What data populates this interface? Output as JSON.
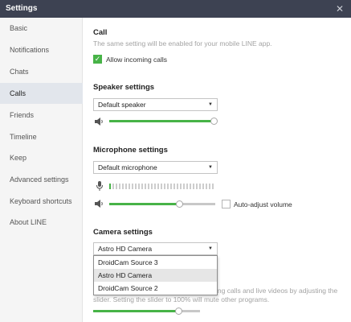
{
  "window": {
    "title": "Settings",
    "close_glyph": "✕"
  },
  "sidebar": {
    "items": [
      {
        "label": "Basic"
      },
      {
        "label": "Notifications"
      },
      {
        "label": "Chats"
      },
      {
        "label": "Calls",
        "active": true
      },
      {
        "label": "Friends"
      },
      {
        "label": "Timeline"
      },
      {
        "label": "Keep"
      },
      {
        "label": "Advanced settings"
      },
      {
        "label": "Keyboard shortcuts"
      },
      {
        "label": "About LINE"
      }
    ]
  },
  "call": {
    "title": "Call",
    "description": "The same setting will be enabled for your mobile LINE app.",
    "allow_incoming": {
      "label": "Allow incoming calls",
      "checked": true
    }
  },
  "speaker": {
    "title": "Speaker settings",
    "selected": "Default speaker",
    "volume_icon": "speaker-icon",
    "volume_fraction": 1.0
  },
  "microphone": {
    "title": "Microphone settings",
    "selected": "Default microphone",
    "mic_icon": "microphone-icon",
    "input_level_fraction": 0.03,
    "volume_fraction": 0.66,
    "auto_adjust": {
      "label": "Auto-adjust volume",
      "checked": false
    }
  },
  "camera": {
    "title": "Camera settings",
    "selected": "Astro HD Camera",
    "options": [
      {
        "label": "DroidCam Source 3"
      },
      {
        "label": "Astro HD Camera",
        "highlighted": true
      },
      {
        "label": "DroidCam Source 2"
      }
    ],
    "bandwidth_text_line1": "ing calls and live videos by adjusting the",
    "bandwidth_text_line2": "slider. Setting the slider to 100% will mute other programs.",
    "bandwidth_fraction": 0.8
  },
  "colors": {
    "accent": "#47b347",
    "titlebar": "#3d4252",
    "sidebar_bg": "#f5f5f5",
    "active_bg": "#e2e6ec"
  }
}
